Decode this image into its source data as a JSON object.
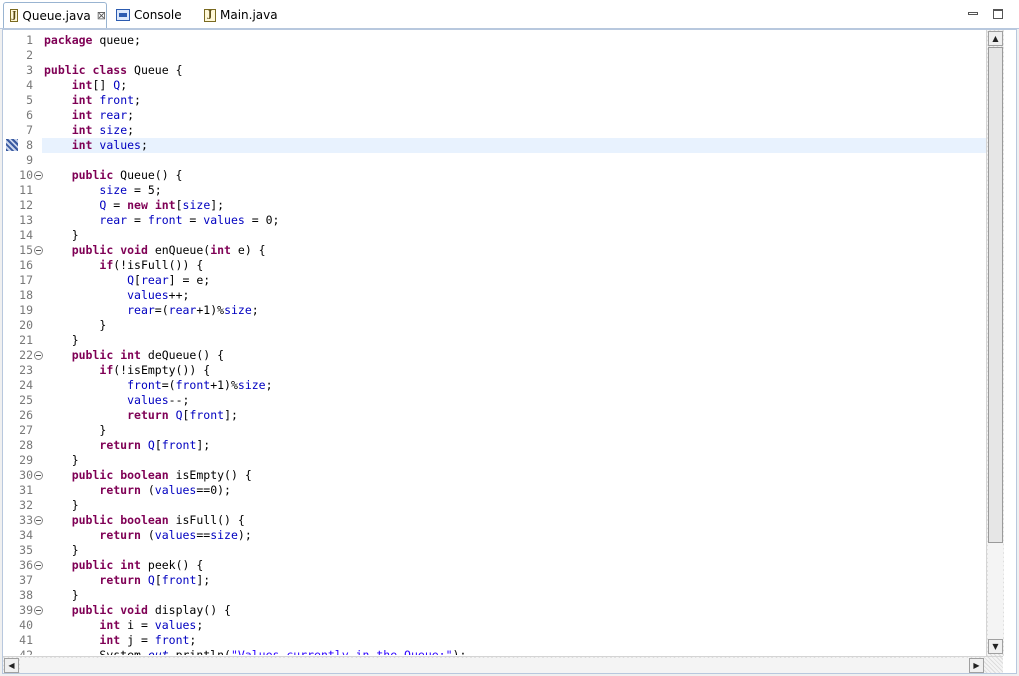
{
  "tabs": [
    {
      "label": "Queue.java",
      "close": "⊠",
      "icon": "java-file-icon",
      "active": true
    },
    {
      "label": "Console",
      "icon": "console-icon",
      "active": false
    },
    {
      "label": "Main.java",
      "icon": "java-file-icon",
      "active": false
    }
  ],
  "window_controls": {
    "minimize": "minimize-icon",
    "maximize": "maximize-icon"
  },
  "editor": {
    "current_line": 8,
    "bookmark_line": 8,
    "lines": [
      {
        "n": "1",
        "fold": false,
        "tokens": [
          {
            "t": "package",
            "c": "kw"
          },
          {
            "t": " queue;"
          }
        ]
      },
      {
        "n": "2",
        "fold": false,
        "tokens": []
      },
      {
        "n": "3",
        "fold": false,
        "tokens": [
          {
            "t": "public",
            "c": "kw"
          },
          {
            "t": " "
          },
          {
            "t": "class",
            "c": "kw"
          },
          {
            "t": " Queue {"
          }
        ]
      },
      {
        "n": "4",
        "fold": false,
        "tokens": [
          {
            "t": "    "
          },
          {
            "t": "int",
            "c": "kw"
          },
          {
            "t": "[] "
          },
          {
            "t": "Q",
            "c": "fld"
          },
          {
            "t": ";"
          }
        ]
      },
      {
        "n": "5",
        "fold": false,
        "tokens": [
          {
            "t": "    "
          },
          {
            "t": "int",
            "c": "kw"
          },
          {
            "t": " "
          },
          {
            "t": "front",
            "c": "fld"
          },
          {
            "t": ";"
          }
        ]
      },
      {
        "n": "6",
        "fold": false,
        "tokens": [
          {
            "t": "    "
          },
          {
            "t": "int",
            "c": "kw"
          },
          {
            "t": " "
          },
          {
            "t": "rear",
            "c": "fld"
          },
          {
            "t": ";"
          }
        ]
      },
      {
        "n": "7",
        "fold": false,
        "tokens": [
          {
            "t": "    "
          },
          {
            "t": "int",
            "c": "kw"
          },
          {
            "t": " "
          },
          {
            "t": "size",
            "c": "fld"
          },
          {
            "t": ";"
          }
        ]
      },
      {
        "n": "8",
        "fold": false,
        "tokens": [
          {
            "t": "    "
          },
          {
            "t": "int",
            "c": "kw"
          },
          {
            "t": " "
          },
          {
            "t": "values",
            "c": "fld"
          },
          {
            "t": ";"
          }
        ]
      },
      {
        "n": "9",
        "fold": false,
        "tokens": []
      },
      {
        "n": "10",
        "fold": true,
        "tokens": [
          {
            "t": "    "
          },
          {
            "t": "public",
            "c": "kw"
          },
          {
            "t": " Queue() {"
          }
        ]
      },
      {
        "n": "11",
        "fold": false,
        "tokens": [
          {
            "t": "        "
          },
          {
            "t": "size",
            "c": "fld"
          },
          {
            "t": " = 5;"
          }
        ]
      },
      {
        "n": "12",
        "fold": false,
        "tokens": [
          {
            "t": "        "
          },
          {
            "t": "Q",
            "c": "fld"
          },
          {
            "t": " = "
          },
          {
            "t": "new",
            "c": "kw"
          },
          {
            "t": " "
          },
          {
            "t": "int",
            "c": "kw"
          },
          {
            "t": "["
          },
          {
            "t": "size",
            "c": "fld"
          },
          {
            "t": "];"
          }
        ]
      },
      {
        "n": "13",
        "fold": false,
        "tokens": [
          {
            "t": "        "
          },
          {
            "t": "rear",
            "c": "fld"
          },
          {
            "t": " = "
          },
          {
            "t": "front",
            "c": "fld"
          },
          {
            "t": " = "
          },
          {
            "t": "values",
            "c": "fld"
          },
          {
            "t": " = 0;"
          }
        ]
      },
      {
        "n": "14",
        "fold": false,
        "tokens": [
          {
            "t": "    }"
          }
        ]
      },
      {
        "n": "15",
        "fold": true,
        "tokens": [
          {
            "t": "    "
          },
          {
            "t": "public",
            "c": "kw"
          },
          {
            "t": " "
          },
          {
            "t": "void",
            "c": "kw"
          },
          {
            "t": " enQueue("
          },
          {
            "t": "int",
            "c": "kw"
          },
          {
            "t": " e) {"
          }
        ]
      },
      {
        "n": "16",
        "fold": false,
        "tokens": [
          {
            "t": "        "
          },
          {
            "t": "if",
            "c": "kw"
          },
          {
            "t": "(!isFull()) {"
          }
        ]
      },
      {
        "n": "17",
        "fold": false,
        "tokens": [
          {
            "t": "            "
          },
          {
            "t": "Q",
            "c": "fld"
          },
          {
            "t": "["
          },
          {
            "t": "rear",
            "c": "fld"
          },
          {
            "t": "] = e;"
          }
        ]
      },
      {
        "n": "18",
        "fold": false,
        "tokens": [
          {
            "t": "            "
          },
          {
            "t": "values",
            "c": "fld"
          },
          {
            "t": "++;"
          }
        ]
      },
      {
        "n": "19",
        "fold": false,
        "tokens": [
          {
            "t": "            "
          },
          {
            "t": "rear",
            "c": "fld"
          },
          {
            "t": "=("
          },
          {
            "t": "rear",
            "c": "fld"
          },
          {
            "t": "+1)%"
          },
          {
            "t": "size",
            "c": "fld"
          },
          {
            "t": ";"
          }
        ]
      },
      {
        "n": "20",
        "fold": false,
        "tokens": [
          {
            "t": "        }"
          }
        ]
      },
      {
        "n": "21",
        "fold": false,
        "tokens": [
          {
            "t": "    }"
          }
        ]
      },
      {
        "n": "22",
        "fold": true,
        "tokens": [
          {
            "t": "    "
          },
          {
            "t": "public",
            "c": "kw"
          },
          {
            "t": " "
          },
          {
            "t": "int",
            "c": "kw"
          },
          {
            "t": " deQueue() {"
          }
        ]
      },
      {
        "n": "23",
        "fold": false,
        "tokens": [
          {
            "t": "        "
          },
          {
            "t": "if",
            "c": "kw"
          },
          {
            "t": "(!isEmpty()) {"
          }
        ]
      },
      {
        "n": "24",
        "fold": false,
        "tokens": [
          {
            "t": "            "
          },
          {
            "t": "front",
            "c": "fld"
          },
          {
            "t": "=("
          },
          {
            "t": "front",
            "c": "fld"
          },
          {
            "t": "+1)%"
          },
          {
            "t": "size",
            "c": "fld"
          },
          {
            "t": ";"
          }
        ]
      },
      {
        "n": "25",
        "fold": false,
        "tokens": [
          {
            "t": "            "
          },
          {
            "t": "values",
            "c": "fld"
          },
          {
            "t": "--;"
          }
        ]
      },
      {
        "n": "26",
        "fold": false,
        "tokens": [
          {
            "t": "            "
          },
          {
            "t": "return",
            "c": "kw"
          },
          {
            "t": " "
          },
          {
            "t": "Q",
            "c": "fld"
          },
          {
            "t": "["
          },
          {
            "t": "front",
            "c": "fld"
          },
          {
            "t": "];"
          }
        ]
      },
      {
        "n": "27",
        "fold": false,
        "tokens": [
          {
            "t": "        }"
          }
        ]
      },
      {
        "n": "28",
        "fold": false,
        "tokens": [
          {
            "t": "        "
          },
          {
            "t": "return",
            "c": "kw"
          },
          {
            "t": " "
          },
          {
            "t": "Q",
            "c": "fld"
          },
          {
            "t": "["
          },
          {
            "t": "front",
            "c": "fld"
          },
          {
            "t": "];"
          }
        ]
      },
      {
        "n": "29",
        "fold": false,
        "tokens": [
          {
            "t": "    }"
          }
        ]
      },
      {
        "n": "30",
        "fold": true,
        "tokens": [
          {
            "t": "    "
          },
          {
            "t": "public",
            "c": "kw"
          },
          {
            "t": " "
          },
          {
            "t": "boolean",
            "c": "kw"
          },
          {
            "t": " isEmpty() {"
          }
        ]
      },
      {
        "n": "31",
        "fold": false,
        "tokens": [
          {
            "t": "        "
          },
          {
            "t": "return",
            "c": "kw"
          },
          {
            "t": " ("
          },
          {
            "t": "values",
            "c": "fld"
          },
          {
            "t": "==0);"
          }
        ]
      },
      {
        "n": "32",
        "fold": false,
        "tokens": [
          {
            "t": "    }"
          }
        ]
      },
      {
        "n": "33",
        "fold": true,
        "tokens": [
          {
            "t": "    "
          },
          {
            "t": "public",
            "c": "kw"
          },
          {
            "t": " "
          },
          {
            "t": "boolean",
            "c": "kw"
          },
          {
            "t": " isFull() {"
          }
        ]
      },
      {
        "n": "34",
        "fold": false,
        "tokens": [
          {
            "t": "        "
          },
          {
            "t": "return",
            "c": "kw"
          },
          {
            "t": " ("
          },
          {
            "t": "values",
            "c": "fld"
          },
          {
            "t": "=="
          },
          {
            "t": "size",
            "c": "fld"
          },
          {
            "t": ");"
          }
        ]
      },
      {
        "n": "35",
        "fold": false,
        "tokens": [
          {
            "t": "    }"
          }
        ]
      },
      {
        "n": "36",
        "fold": true,
        "tokens": [
          {
            "t": "    "
          },
          {
            "t": "public",
            "c": "kw"
          },
          {
            "t": " "
          },
          {
            "t": "int",
            "c": "kw"
          },
          {
            "t": " peek() {"
          }
        ]
      },
      {
        "n": "37",
        "fold": false,
        "tokens": [
          {
            "t": "        "
          },
          {
            "t": "return",
            "c": "kw"
          },
          {
            "t": " "
          },
          {
            "t": "Q",
            "c": "fld"
          },
          {
            "t": "["
          },
          {
            "t": "front",
            "c": "fld"
          },
          {
            "t": "];"
          }
        ]
      },
      {
        "n": "38",
        "fold": false,
        "tokens": [
          {
            "t": "    }"
          }
        ]
      },
      {
        "n": "39",
        "fold": true,
        "tokens": [
          {
            "t": "    "
          },
          {
            "t": "public",
            "c": "kw"
          },
          {
            "t": " "
          },
          {
            "t": "void",
            "c": "kw"
          },
          {
            "t": " display() {"
          }
        ]
      },
      {
        "n": "40",
        "fold": false,
        "tokens": [
          {
            "t": "        "
          },
          {
            "t": "int",
            "c": "kw"
          },
          {
            "t": " i = "
          },
          {
            "t": "values",
            "c": "fld"
          },
          {
            "t": ";"
          }
        ]
      },
      {
        "n": "41",
        "fold": false,
        "tokens": [
          {
            "t": "        "
          },
          {
            "t": "int",
            "c": "kw"
          },
          {
            "t": " j = "
          },
          {
            "t": "front",
            "c": "fld"
          },
          {
            "t": ";"
          }
        ]
      },
      {
        "n": "42",
        "fold": false,
        "tokens": [
          {
            "t": "        System."
          },
          {
            "t": "out",
            "c": "fld it"
          },
          {
            "t": ".println("
          },
          {
            "t": "\"Values currently in the Queue:\"",
            "c": "str"
          },
          {
            "t": ");"
          }
        ]
      }
    ]
  },
  "scrollbars": {
    "up": "▲",
    "down": "▼",
    "left": "◀",
    "right": "▶"
  },
  "colors": {
    "keyword": "#7f0055",
    "field": "#0000c0",
    "string": "#2a00ff",
    "current_line": "#e8f2fe",
    "line_number": "#787878"
  }
}
